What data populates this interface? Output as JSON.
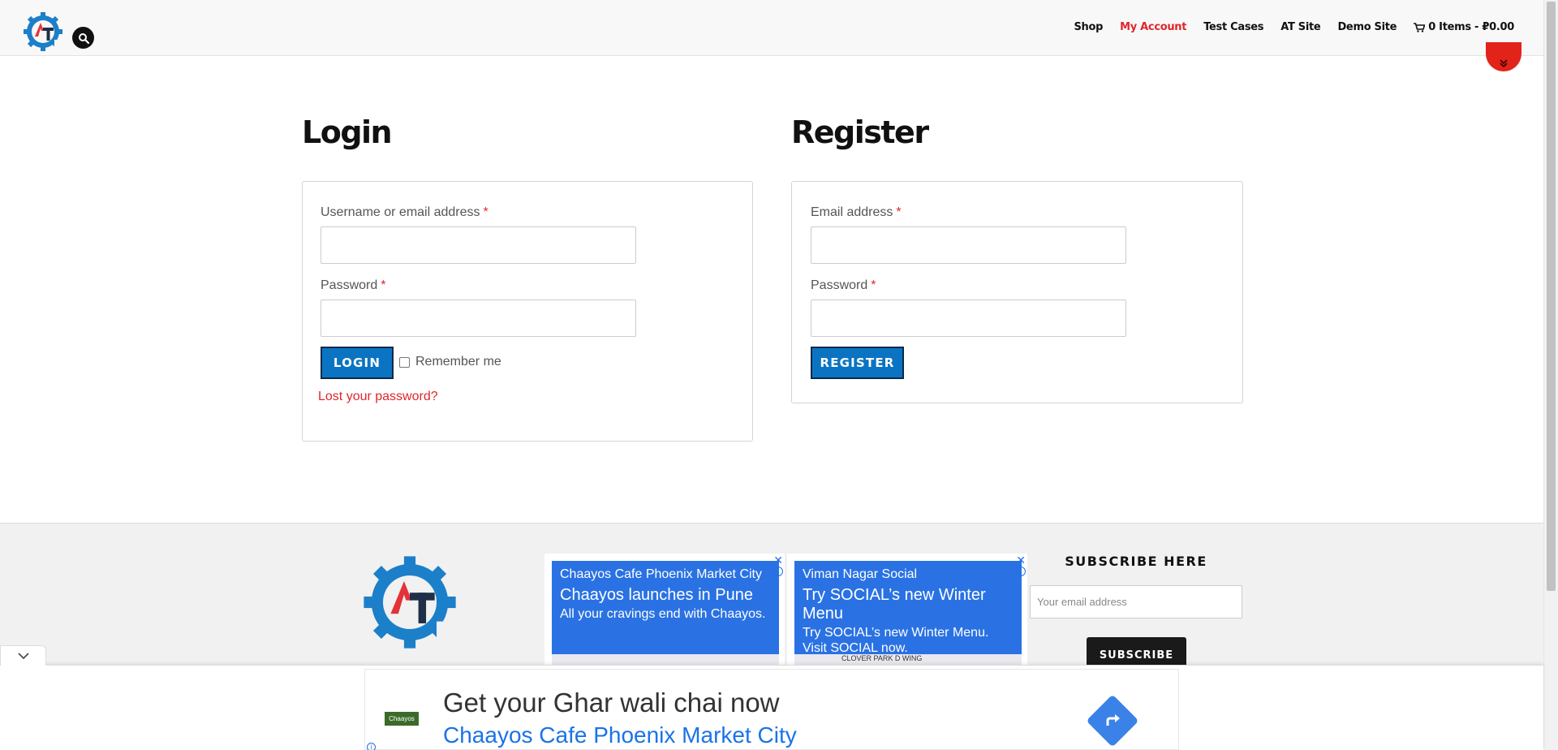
{
  "header": {
    "nav": [
      {
        "label": "Shop"
      },
      {
        "label": "My Account",
        "active": true
      },
      {
        "label": "Test Cases"
      },
      {
        "label": "AT Site"
      },
      {
        "label": "Demo Site"
      }
    ],
    "cart_label": "0 Items - ₽0.00"
  },
  "login": {
    "title": "Login",
    "username_label": "Username or email address",
    "password_label": "Password",
    "required_mark": "*",
    "button": "LOGIN",
    "remember_label": "Remember me",
    "lost_password": "Lost your password?"
  },
  "register": {
    "title": "Register",
    "email_label": "Email address",
    "password_label": "Password",
    "required_mark": "*",
    "button": "REGISTER"
  },
  "footer": {
    "ads": [
      {
        "brand": "Chaayos Cafe Phoenix Market City",
        "headline": "Chaayos launches in Pune",
        "description": "All your cravings end with Chaayos.",
        "map_text": ""
      },
      {
        "brand": "Viman Nagar Social",
        "headline": "Try SOCIAL’s new Winter Menu",
        "description": "Try SOCIAL’s new Winter Menu. Visit SOCIAL now.",
        "map_text": "CLOVER PARK          D WING"
      }
    ],
    "subscribe": {
      "title": "SUBSCRIBE HERE",
      "placeholder": "Your email address",
      "button": "SUBSCRIBE"
    }
  },
  "anchor_ad": {
    "logo_text": "Chaayos",
    "headline": "Get your Ghar wali chai now",
    "subline": "Chaayos Cafe Phoenix Market City"
  },
  "colors": {
    "accent_red": "#e0262b",
    "button_blue": "#0b74c2",
    "ad_blue": "#2a72e3",
    "logo_blue": "#1c7fc9",
    "logo_navy": "#1f2f47"
  }
}
